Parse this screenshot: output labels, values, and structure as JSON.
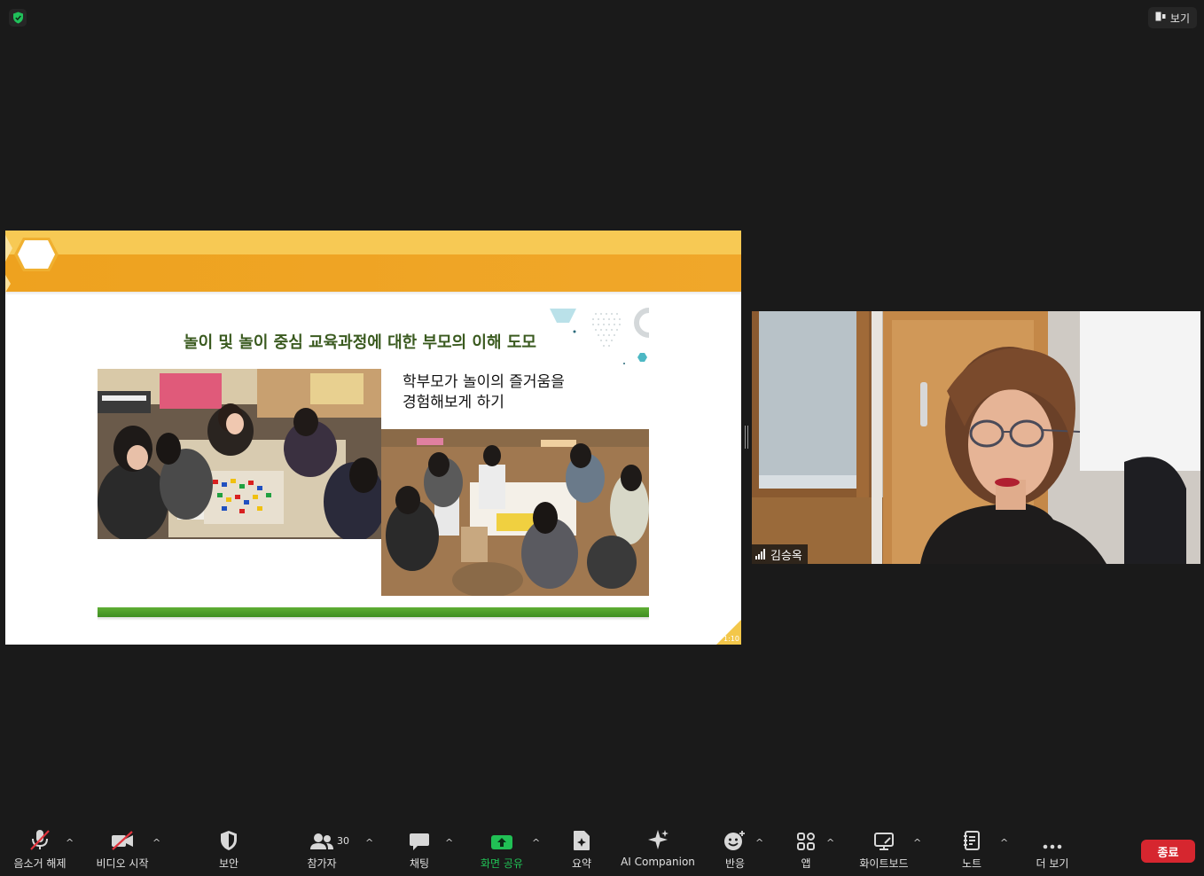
{
  "top_bar": {
    "security_icon": "green-shield-check-icon",
    "view_label": "보기"
  },
  "slide": {
    "title": "놀이 및 놀이 중심 교육과정에 대한 부모의 이해 도모",
    "subtitle_line1": "학부모가 놀이의 즐거움을",
    "subtitle_line2": "경험해보게 하기",
    "page_number": "1:10",
    "colors": {
      "band_yellow": "#f7c954",
      "band_orange": "#eea21f",
      "title_green": "#3a5a1f",
      "bar_green": "#4e9e2b"
    }
  },
  "video": {
    "participant_name": "김승옥"
  },
  "toolbar": {
    "unmute_label": "음소거 해제",
    "start_video_label": "비디오 시작",
    "security_label": "보안",
    "participants_label": "참가자",
    "participants_count": "30",
    "chat_label": "채팅",
    "share_screen_label": "화면 공유",
    "summary_label": "요약",
    "ai_companion_label": "AI Companion",
    "reactions_label": "반응",
    "apps_label": "앱",
    "whiteboard_label": "화이트보드",
    "notes_label": "노트",
    "more_label": "더 보기",
    "end_label": "종료",
    "colors": {
      "share_green": "#21c055",
      "end_red": "#d6262f"
    }
  }
}
